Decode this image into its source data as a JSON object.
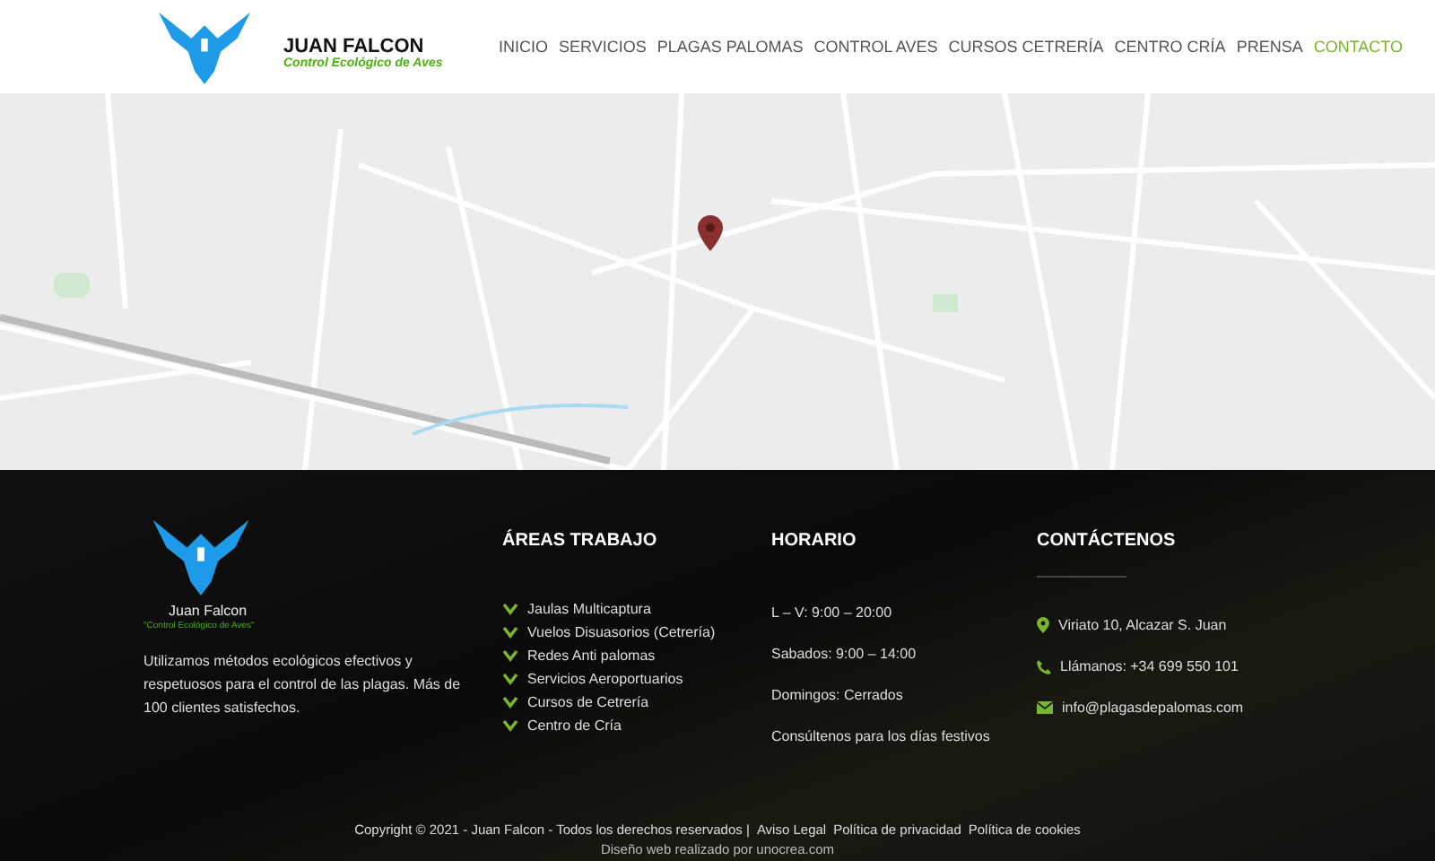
{
  "header": {
    "brand": {
      "name": "JUAN FALCON",
      "tagline": "Control Ecológico de Aves"
    },
    "nav": [
      {
        "label": "INICIO",
        "selected": false
      },
      {
        "label": "SERVICIOS",
        "selected": false
      },
      {
        "label": "PLAGAS PALOMAS",
        "selected": false
      },
      {
        "label": "CONTROL AVES",
        "selected": false
      },
      {
        "label": "CURSOS CETRERÍA",
        "selected": false
      },
      {
        "label": "CENTRO CRÍA",
        "selected": false
      },
      {
        "label": "PRENSA",
        "selected": false
      },
      {
        "label": "CONTACTO",
        "selected": true
      }
    ]
  },
  "footer": {
    "about": {
      "name": "Juan Falcon",
      "tagline": "\"Control Ecológico de Aves\"",
      "text": "Utilizamos métodos ecológicos efectivos y respetuosos para el control de las plagas. Más de 100 clientes satisfechos."
    },
    "areas": {
      "title": "ÁREAS TRABAJO",
      "items": [
        "Jaulas Multicaptura",
        "Vuelos Disuasorios (Cetrería)",
        "Redes Anti palomas",
        "Servicios Aeroportuarios",
        "Cursos de Cetrería",
        "Centro de Cría"
      ]
    },
    "schedule": {
      "title": "HORARIO",
      "items": [
        "L – V: 9:00 – 20:00",
        "Sabados: 9:00 – 14:00",
        "Domingos: Cerrados",
        "Consúltenos para los días festivos"
      ]
    },
    "contact": {
      "title": "CONTÁCTENOS",
      "items": [
        {
          "kind": "location",
          "text": "Viriato 10, Alcazar S. Juan"
        },
        {
          "kind": "phone",
          "text": "Llámanos: +34 699 550 101"
        },
        {
          "kind": "email",
          "text": "info@plagasdepalomas.com"
        }
      ]
    },
    "copyright": "Copyright © 2021 - Juan Falcon - Todos los derechos reservados |",
    "legal_links": [
      "Aviso Legal",
      "Política de privacidad",
      "Política de cookies"
    ],
    "credit": "Diseño web realizado por unocrea.com"
  }
}
